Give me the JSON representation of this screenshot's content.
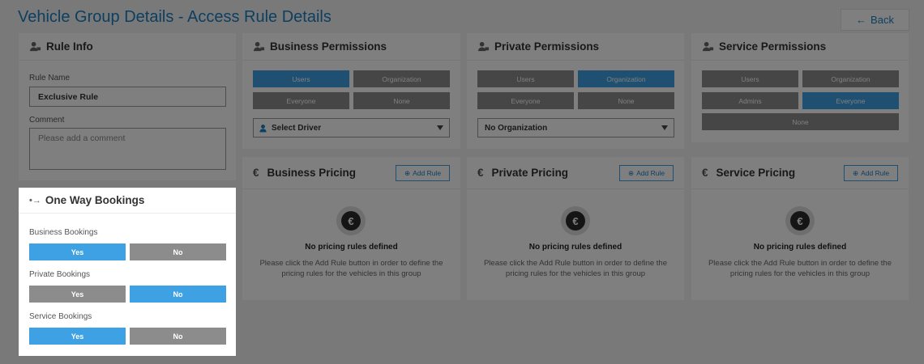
{
  "page": {
    "title": "Vehicle Group Details - Access Rule Details",
    "back_label": "Back"
  },
  "rule_info": {
    "title": "Rule Info",
    "name_label": "Rule Name",
    "name_value": "Exclusive Rule",
    "comment_label": "Comment",
    "comment_placeholder": "Please add a comment"
  },
  "one_way": {
    "title": "One Way Bookings",
    "groups": [
      {
        "label": "Business Bookings",
        "yes": "Yes",
        "no": "No",
        "selected": "yes"
      },
      {
        "label": "Private Bookings",
        "yes": "Yes",
        "no": "No",
        "selected": "no"
      },
      {
        "label": "Service Bookings",
        "yes": "Yes",
        "no": "No",
        "selected": "yes"
      }
    ]
  },
  "permissions": [
    {
      "title": "Business Permissions",
      "buttons": [
        "Users",
        "Organization",
        "Everyone",
        "None"
      ],
      "active": "Users",
      "select_value": "Select Driver"
    },
    {
      "title": "Private Permissions",
      "buttons": [
        "Users",
        "Organization",
        "Everyone",
        "None"
      ],
      "active": "Organization",
      "select_value": "No Organization"
    },
    {
      "title": "Service Permissions",
      "buttons": [
        "Users",
        "Organization",
        "Admins",
        "Everyone",
        "None"
      ],
      "active": "Everyone"
    }
  ],
  "pricing": [
    {
      "title": "Business Pricing",
      "add_label": "Add Rule"
    },
    {
      "title": "Private Pricing",
      "add_label": "Add Rule"
    },
    {
      "title": "Service Pricing",
      "add_label": "Add Rule"
    }
  ],
  "pricing_empty": {
    "heading": "No pricing rules defined",
    "line1": "Please click the Add Rule button in order to define the",
    "line2": "pricing rules for the vehicles in this group"
  },
  "colors": {
    "accent": "#3ea1e3",
    "title_blue": "#1a7fc1",
    "inactive": "#8c8c8c"
  }
}
